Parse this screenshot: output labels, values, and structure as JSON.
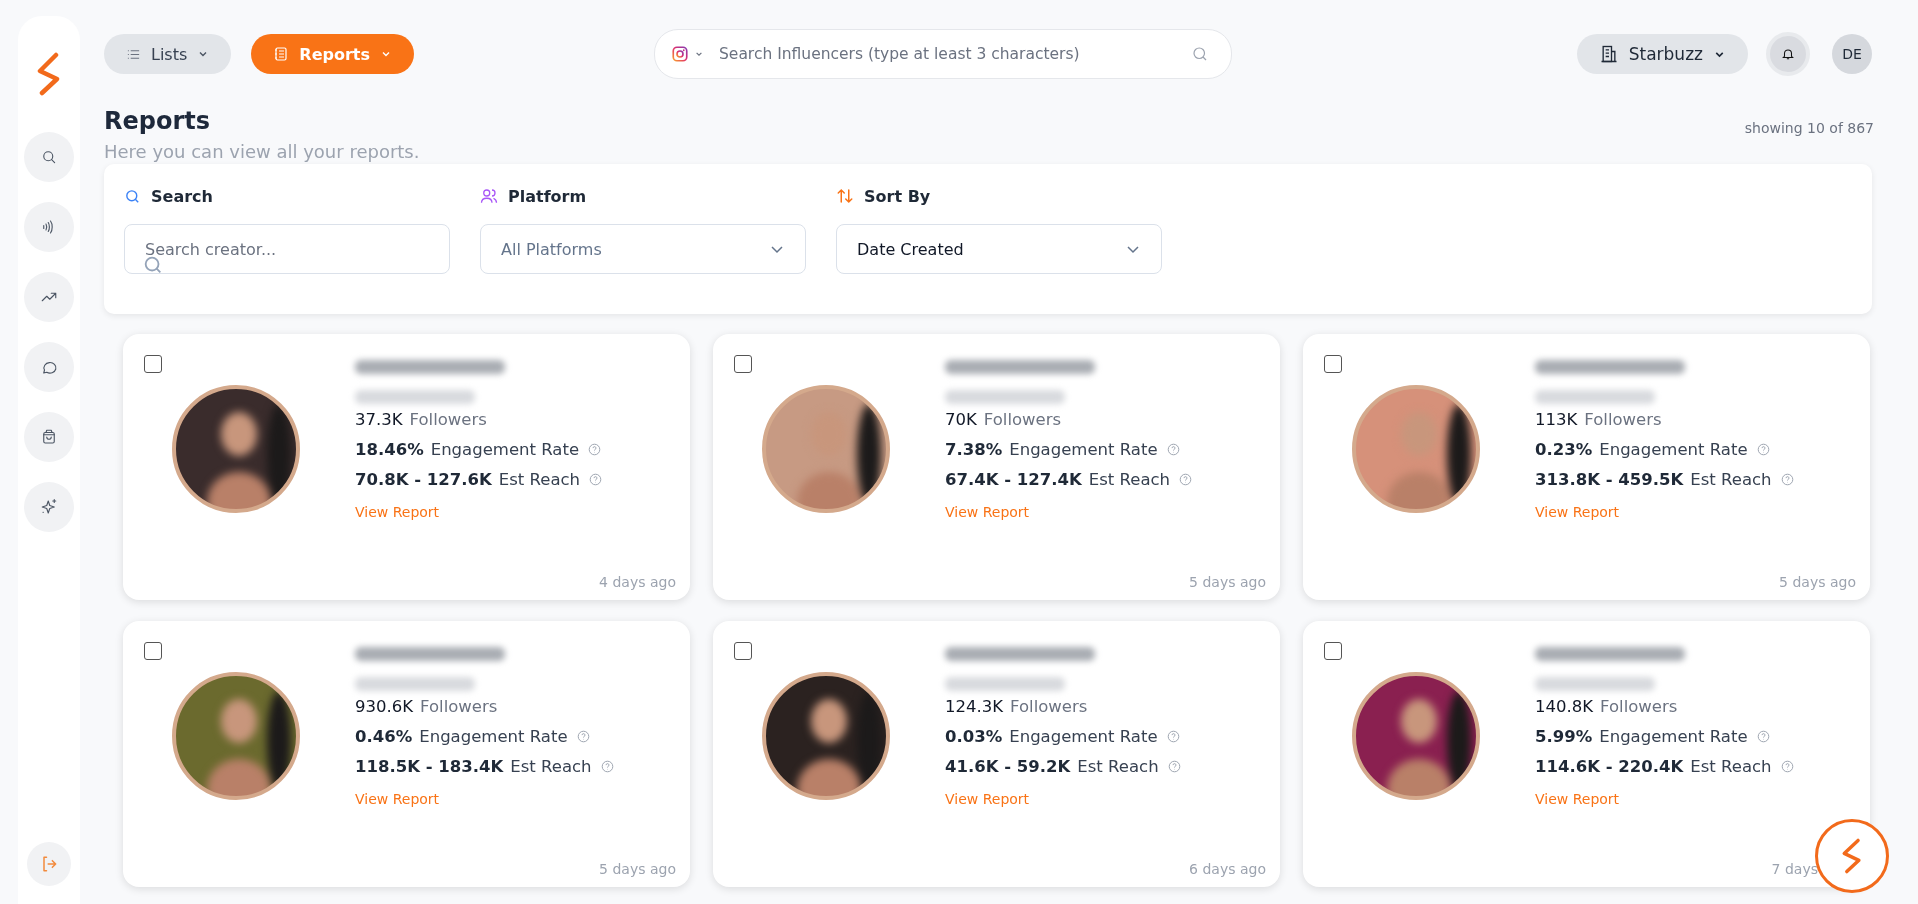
{
  "topbar": {
    "lists": "Lists",
    "reports": "Reports",
    "search_placeholder": "Search Influencers (type at least 3 characters)",
    "workspace": "Starbuzz",
    "avatar": "DE"
  },
  "header": {
    "title": "Reports",
    "subtitle": "Here you can view all your reports.",
    "count": "showing 10 of 867"
  },
  "filters": {
    "search_label": "Search",
    "search_placeholder": "Search creator...",
    "platform_label": "Platform",
    "platform_value": "All Platforms",
    "sort_label": "Sort By",
    "sort_value": "Date Created"
  },
  "cards": [
    {
      "checked": false,
      "followers": "37.3K",
      "followers_label": "Followers",
      "engagement": "18.46%",
      "engagement_label": "Engagement Rate",
      "reach": "70.8K - 127.6K",
      "reach_label": "Est Reach",
      "link": "View Report",
      "time": "4 days ago",
      "color": "#3a2c2c"
    },
    {
      "checked": false,
      "followers": "70K",
      "followers_label": "Followers",
      "engagement": "7.38%",
      "engagement_label": "Engagement Rate",
      "reach": "67.4K - 127.4K",
      "reach_label": "Est Reach",
      "link": "View Report",
      "time": "5 days ago",
      "color": "#c79a83"
    },
    {
      "checked": false,
      "followers": "113K",
      "followers_label": "Followers",
      "engagement": "0.23%",
      "engagement_label": "Engagement Rate",
      "reach": "313.8K - 459.5K",
      "reach_label": "Est Reach",
      "link": "View Report",
      "time": "5 days ago",
      "color": "#d6917a"
    },
    {
      "checked": false,
      "followers": "930.6K",
      "followers_label": "Followers",
      "engagement": "0.46%",
      "engagement_label": "Engagement Rate",
      "reach": "118.5K - 183.4K",
      "reach_label": "Est Reach",
      "link": "View Report",
      "time": "5 days ago",
      "color": "#6b6a2e"
    },
    {
      "checked": false,
      "followers": "124.3K",
      "followers_label": "Followers",
      "engagement": "0.03%",
      "engagement_label": "Engagement Rate",
      "reach": "41.6K - 59.2K",
      "reach_label": "Est Reach",
      "link": "View Report",
      "time": "6 days ago",
      "color": "#2b2220"
    },
    {
      "checked": false,
      "followers": "140.8K",
      "followers_label": "Followers",
      "engagement": "5.99%",
      "engagement_label": "Engagement Rate",
      "reach": "114.6K - 220.4K",
      "reach_label": "Est Reach",
      "link": "View Report",
      "time": "7 days",
      "color": "#8a2050"
    }
  ]
}
